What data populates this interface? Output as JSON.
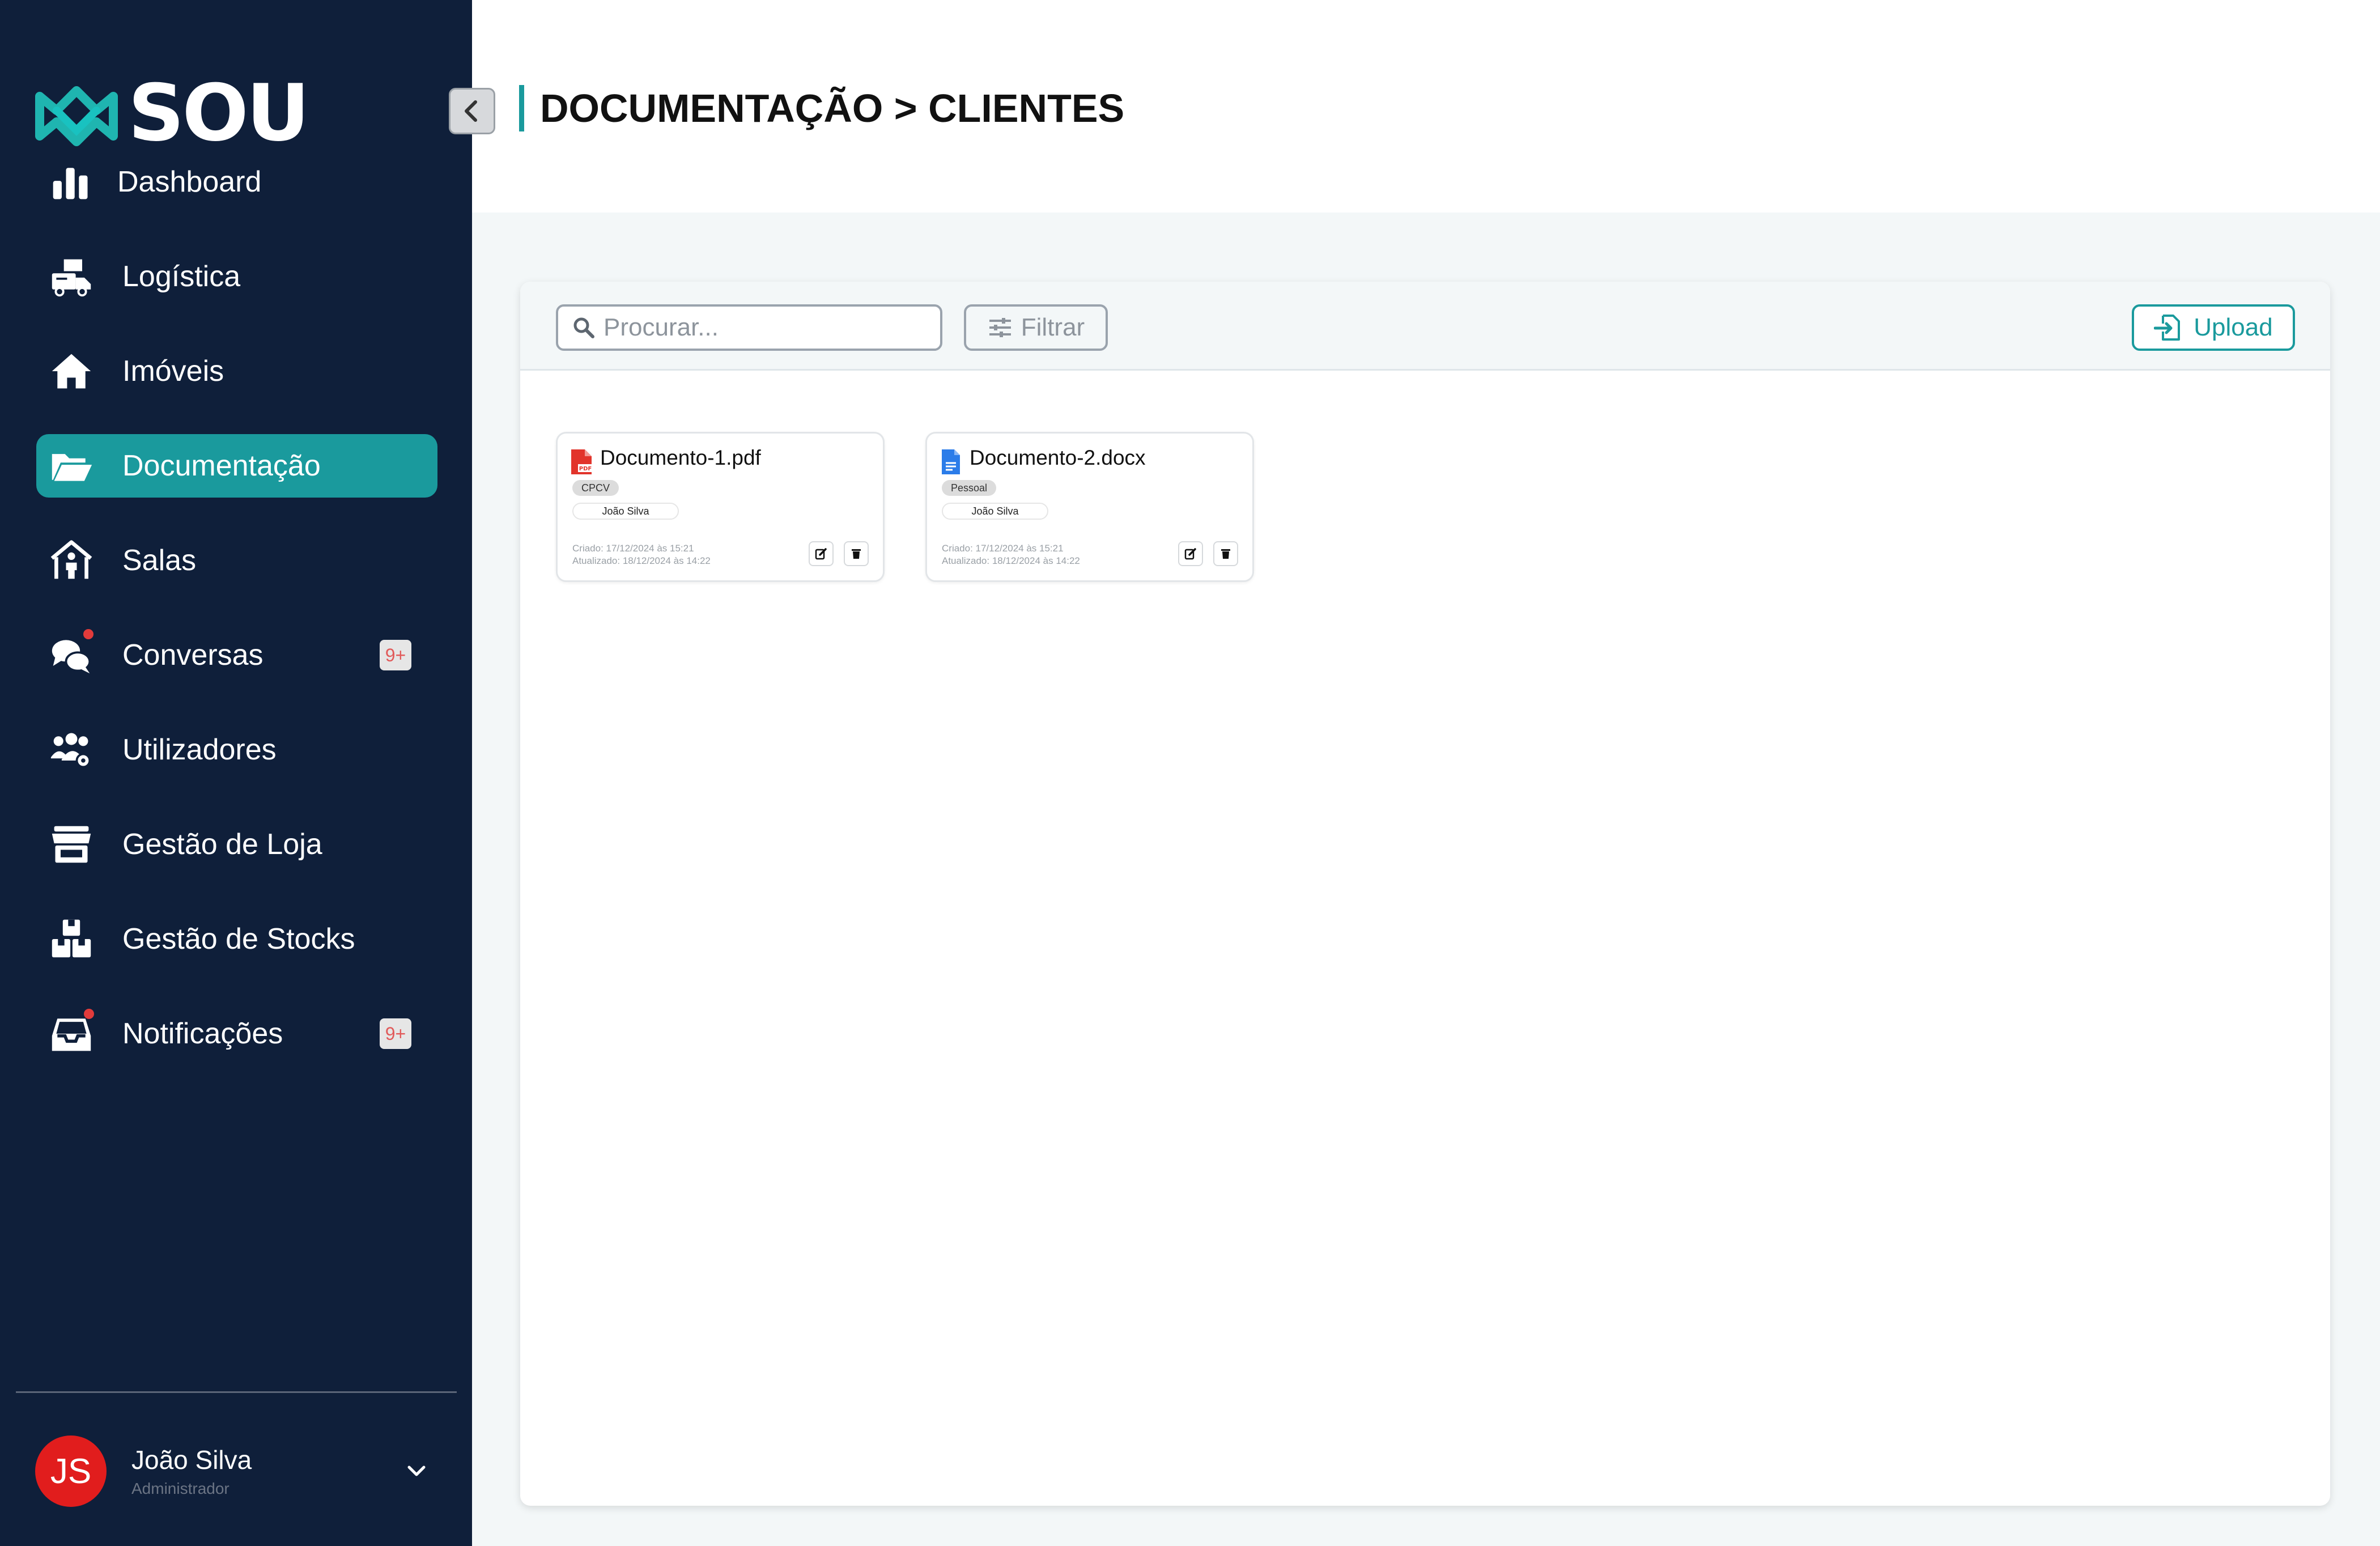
{
  "brand": {
    "name": "SOU",
    "accent": "#1a9a9d",
    "sidebar_bg": "#0f1f3a"
  },
  "sidebar": {
    "items": [
      {
        "label": "Dashboard",
        "icon": "bar-chart-icon",
        "active": false
      },
      {
        "label": "Logística",
        "icon": "truck-box-icon",
        "active": false
      },
      {
        "label": "Imóveis",
        "icon": "house-icon",
        "active": false
      },
      {
        "label": "Documentação",
        "icon": "folder-open-icon",
        "active": true
      },
      {
        "label": "Salas",
        "icon": "room-icon",
        "active": false
      },
      {
        "label": "Conversas",
        "icon": "chat-icon",
        "active": false,
        "badge": "9+"
      },
      {
        "label": "Utilizadores",
        "icon": "users-gear-icon",
        "active": false
      },
      {
        "label": "Gestão de Loja",
        "icon": "store-icon",
        "active": false
      },
      {
        "label": "Gestão de Stocks",
        "icon": "boxes-icon",
        "active": false
      },
      {
        "label": "Notificações",
        "icon": "inbox-icon",
        "active": false,
        "badge": "9+"
      }
    ]
  },
  "user": {
    "initials": "JS",
    "name": "João Silva",
    "role": "Administrador"
  },
  "header": {
    "title": "DOCUMENTAÇÃO > CLIENTES"
  },
  "toolbar": {
    "search_placeholder": "Procurar...",
    "filter_label": "Filtrar",
    "upload_label": "Upload"
  },
  "documents": [
    {
      "name": "Documento-1.pdf",
      "type": "pdf",
      "tag": "CPCV",
      "owner": "João Silva",
      "created": "Criado: 17/12/2024 às 15:21",
      "updated": "Atualizado: 18/12/2024 às 14:22"
    },
    {
      "name": "Documento-2.docx",
      "type": "docx",
      "tag": "Pessoal",
      "owner": "João Silva",
      "created": "Criado: 17/12/2024 às 15:21",
      "updated": "Atualizado: 18/12/2024 às 14:22"
    }
  ]
}
